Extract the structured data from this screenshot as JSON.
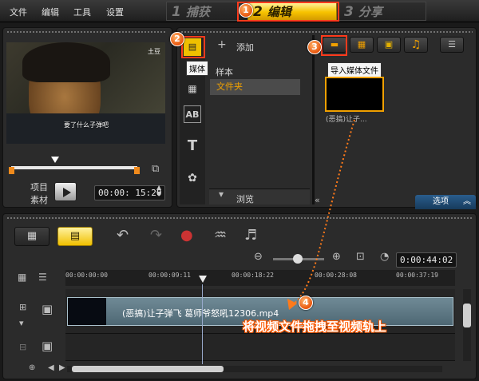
{
  "menu": {
    "file": "文件",
    "edit": "编辑",
    "tools": "工具",
    "settings": "设置"
  },
  "steps": [
    {
      "number": "1",
      "label": "捕获"
    },
    {
      "number": "2",
      "label": "编辑"
    },
    {
      "number": "3",
      "label": "分享"
    }
  ],
  "callouts": {
    "c1": "1",
    "c2": "2",
    "c3": "3",
    "c4": "4"
  },
  "preview": {
    "watermark": "土豆",
    "subtitle": "要了什么子弹吧",
    "project_label": "项目",
    "clip_label": "素材",
    "timecode": "00:00: 15:20"
  },
  "library": {
    "add_label": "添加",
    "media_tooltip": "媒体",
    "sample_label": "样本",
    "folder_label": "文件夹",
    "browse_label": "浏览",
    "import_tooltip": "导入媒体文件",
    "thumb_caption": "(恶搞)让子...",
    "options_label": "选项"
  },
  "timeline": {
    "timecode": "0:00:44:02",
    "ruler": [
      "00:00:00:00",
      "00:00:09:11",
      "00:00:18:22",
      "00:00:28:08",
      "00:00:37:19"
    ],
    "clip_name": "(恶搞)让子弹飞 葛师爷怒吼12306.mp4",
    "annotation": "将视频文件拖拽至视频轨上"
  },
  "colors": {
    "accent": "#f0c000",
    "callout": "#ff5a00",
    "selection": "#f0a000"
  }
}
